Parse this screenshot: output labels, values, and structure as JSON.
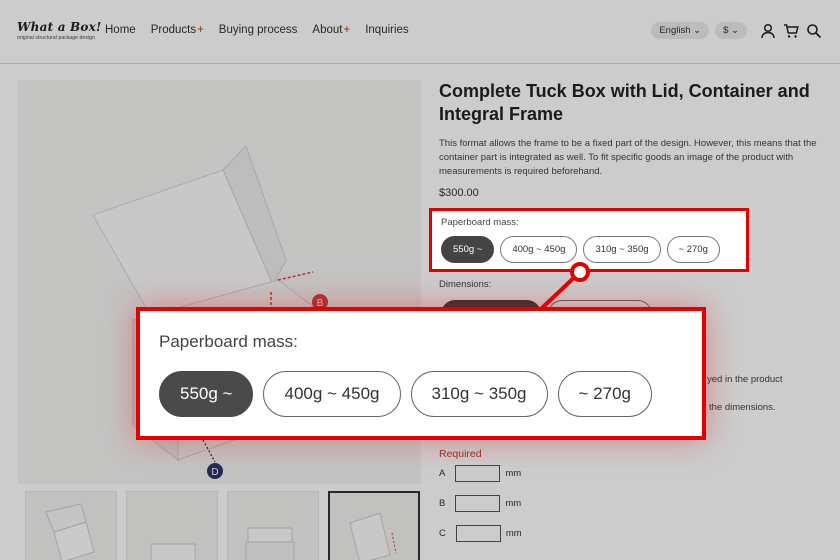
{
  "header": {
    "logo_text": "What a Box!",
    "logo_tagline": "original structural package design",
    "nav": [
      {
        "label": "Home",
        "has_plus": false
      },
      {
        "label": "Products",
        "has_plus": true
      },
      {
        "label": "Buying process",
        "has_plus": false
      },
      {
        "label": "About",
        "has_plus": true
      },
      {
        "label": "Inquiries",
        "has_plus": false
      }
    ],
    "plus_symbol": "+",
    "language": "English ⌄",
    "currency": "$ ⌄",
    "icons": [
      "user-icon",
      "cart-icon",
      "search-icon"
    ]
  },
  "gallery": {
    "markers": [
      "B",
      "D"
    ],
    "thumbnail_count": 4
  },
  "product": {
    "title": "Complete Tuck Box with Lid, Container and Integral Frame",
    "description": "This format allows the frame to be a fixed part of the design. However, this means that the container part is integrated as well. To fit specific goods an image of the product with measurements is required beforehand.",
    "price": "$300.00",
    "paperboard_label": "Paperboard mass:",
    "paperboard_options": [
      "550g ~",
      "400g ~ 450g",
      "310g ~ 350g",
      "~ 270g"
    ],
    "paperboard_selected": "550g ~",
    "dimensions_label": "Dimensions:",
    "partial_text_1": "yed in the product",
    "partial_text_2": "the dimensions.",
    "required_label": "Required",
    "dimension_fields": [
      {
        "label": "A",
        "unit": "mm",
        "value": ""
      },
      {
        "label": "B",
        "unit": "mm",
        "value": ""
      },
      {
        "label": "C",
        "unit": "mm",
        "value": ""
      }
    ]
  },
  "colors": {
    "highlight": "#e40000",
    "accent_red": "#c0392b",
    "selected_option": "#444444"
  }
}
